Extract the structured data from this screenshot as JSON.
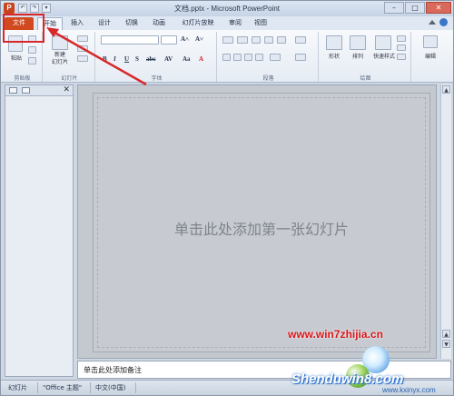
{
  "window": {
    "title": "文档.pptx - Microsoft PowerPoint",
    "app_icon": "P",
    "qat": [
      "↶",
      "↷",
      "▾"
    ],
    "controls": {
      "minimize": "–",
      "maximize": "□",
      "close": "✕"
    }
  },
  "tabs": [
    {
      "label": "文件"
    },
    {
      "label": "开始"
    },
    {
      "label": "插入"
    },
    {
      "label": "设计"
    },
    {
      "label": "切换"
    },
    {
      "label": "动画"
    },
    {
      "label": "幻灯片放映"
    },
    {
      "label": "审阅"
    },
    {
      "label": "视图"
    }
  ],
  "ribbon": {
    "clipboard": {
      "label": "剪贴板",
      "paste": "粘贴"
    },
    "slides": {
      "label": "幻灯片",
      "new_slide": "新建\n幻灯片"
    },
    "font": {
      "label": "字体"
    },
    "paragraph": {
      "label": "段落"
    },
    "drawing": {
      "label": "绘图",
      "shapes": "形状",
      "arrange": "排列",
      "quick_styles": "快速样式"
    },
    "editing": {
      "label": "编辑"
    }
  },
  "slide": {
    "title_placeholder": "单击此处添加第一张幻灯片"
  },
  "notes": {
    "placeholder": "单击此处添加备注"
  },
  "status": {
    "slide": "幻灯片",
    "theme": "\"Office 主题\"",
    "language": "中文(中国)"
  },
  "watermark": {
    "site1": "www.win7zhijia.cn",
    "site2": "Shenduwin8.com",
    "site3": "www.kxinyx.com"
  },
  "colors": {
    "file_tab": "#d2491f",
    "highlight": "#d8282a"
  }
}
